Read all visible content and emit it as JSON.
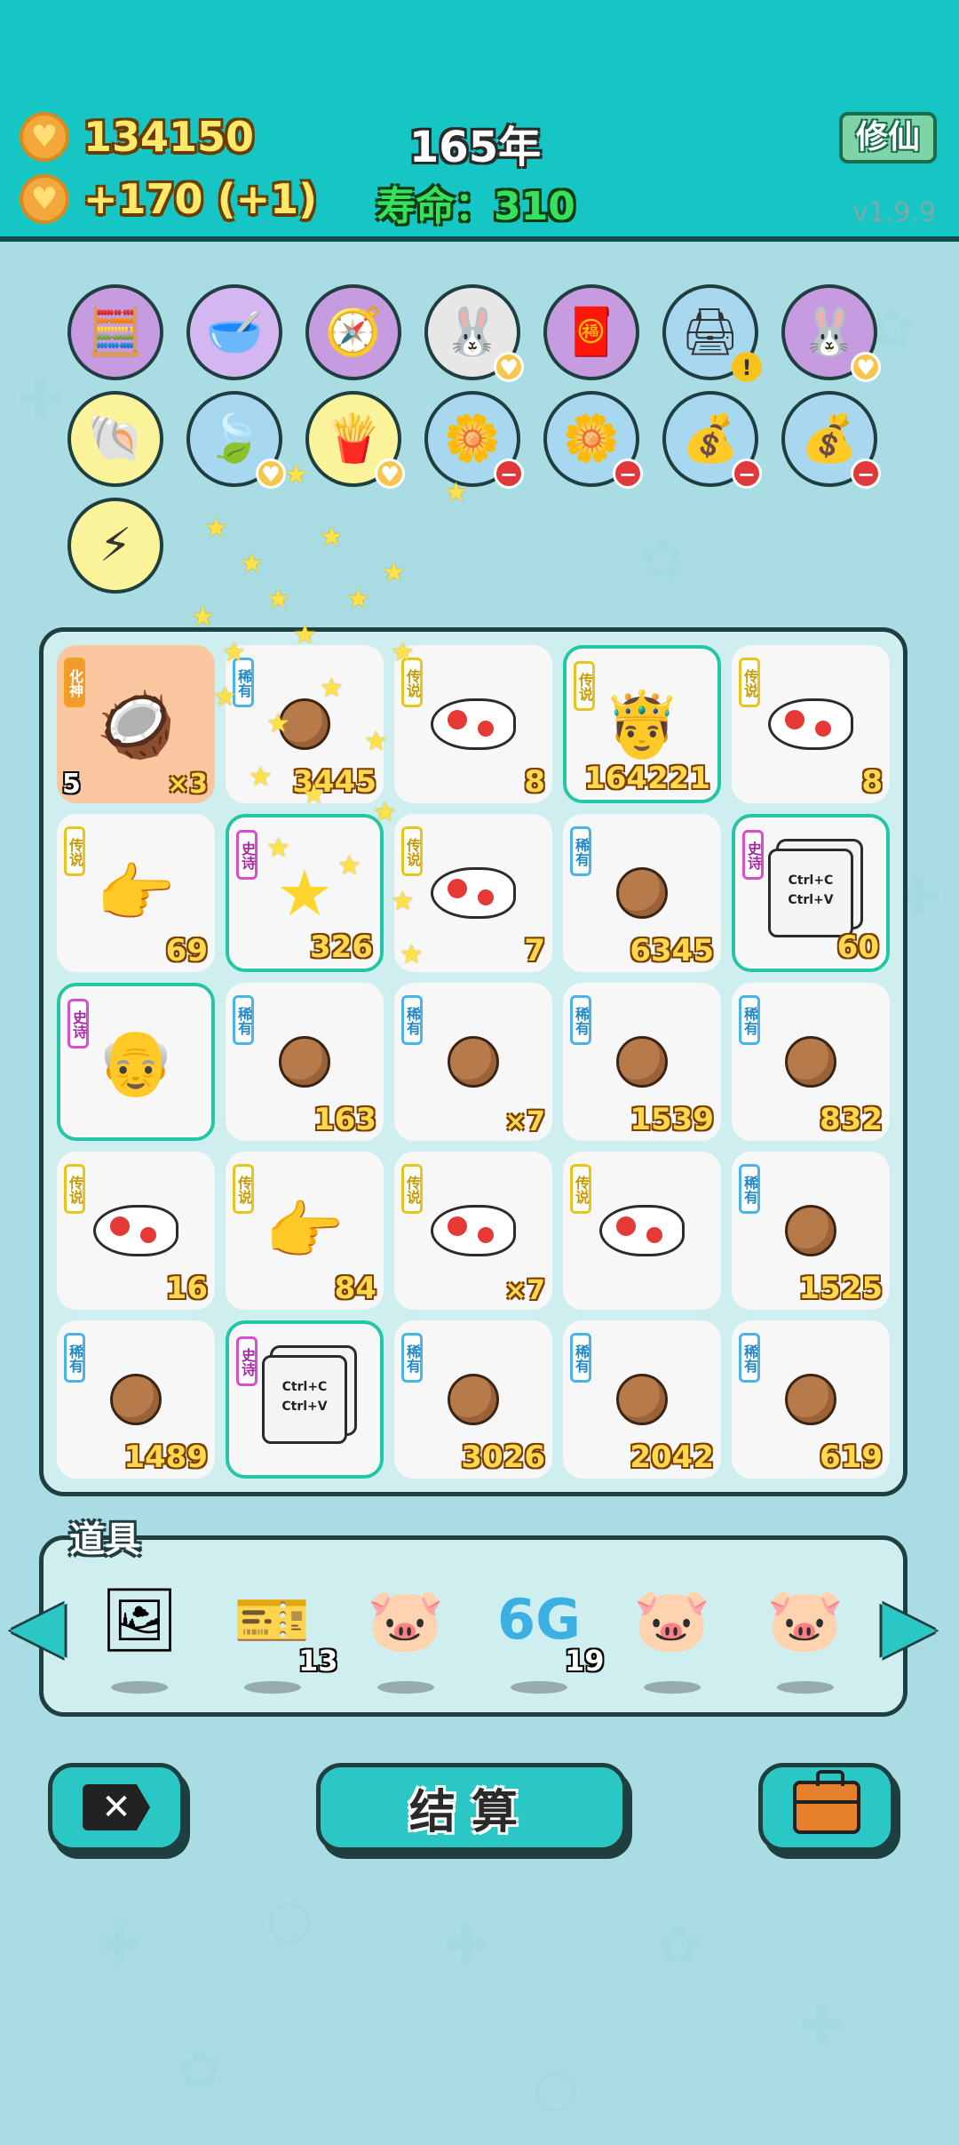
{
  "header": {
    "coins": "134150",
    "income": "+170 (+1)",
    "year": "165年",
    "lifespan": "寿命：310",
    "cultivate_button": "修仙",
    "version": "v1.9.9"
  },
  "buffs": [
    {
      "name": "math-buff",
      "icon": "🧮"
    },
    {
      "name": "pet-bowl-buff",
      "icon": "🥣"
    },
    {
      "name": "compass-buff",
      "icon": "🧭"
    },
    {
      "name": "rabbit-buff",
      "icon": "🐰"
    },
    {
      "name": "red-envelope-buff",
      "icon": "🧧"
    },
    {
      "name": "printer-buff",
      "icon": "🖨"
    },
    {
      "name": "rabbit-buff-2",
      "icon": "🐰"
    },
    {
      "name": "shell-buff",
      "icon": "🐚"
    },
    {
      "name": "leaf-buff",
      "icon": "🍃"
    },
    {
      "name": "fries-buff",
      "icon": "🍟"
    },
    {
      "name": "flower-pot-buff",
      "icon": "🌼"
    },
    {
      "name": "flower-pot-buff-2",
      "icon": "🌼"
    },
    {
      "name": "sack-buff",
      "icon": "💰"
    },
    {
      "name": "sack-buff-2",
      "icon": "💰"
    },
    {
      "name": "lightning-buff",
      "icon": "⚡"
    }
  ],
  "badges": {
    "rare": "稀有",
    "legend": "传说",
    "epic": "史诗",
    "transform": "化神"
  },
  "board": {
    "tiles": [
      {
        "rarity": "transform",
        "item": "coconuts",
        "left_value": "5",
        "value": "×3"
      },
      {
        "rarity": "rare",
        "item": "nut",
        "value": "3445"
      },
      {
        "rarity": "legend",
        "item": "fish",
        "value": "8"
      },
      {
        "rarity": "legend",
        "item": "king",
        "value": "164221"
      },
      {
        "rarity": "legend",
        "item": "fish",
        "value": "8"
      },
      {
        "rarity": "legend",
        "item": "hand",
        "value": "69"
      },
      {
        "rarity": "epic",
        "item": "star-cluster",
        "value": "326"
      },
      {
        "rarity": "legend",
        "item": "fish",
        "value": "7"
      },
      {
        "rarity": "rare",
        "item": "nut",
        "value": "6345"
      },
      {
        "rarity": "epic",
        "item": "copy-paste",
        "value": "60"
      },
      {
        "rarity": "epic",
        "item": "old-man",
        "value": ""
      },
      {
        "rarity": "rare",
        "item": "nut",
        "value": "163"
      },
      {
        "rarity": "rare",
        "item": "nut",
        "value": "×7"
      },
      {
        "rarity": "rare",
        "item": "nut",
        "value": "1539"
      },
      {
        "rarity": "rare",
        "item": "nut",
        "value": "832"
      },
      {
        "rarity": "legend",
        "item": "fish",
        "value": "16"
      },
      {
        "rarity": "legend",
        "item": "hand",
        "value": "84"
      },
      {
        "rarity": "legend",
        "item": "fish",
        "value": "×7"
      },
      {
        "rarity": "legend",
        "item": "fish",
        "value": ""
      },
      {
        "rarity": "rare",
        "item": "nut",
        "value": "1525"
      },
      {
        "rarity": "rare",
        "item": "nut",
        "value": "1489"
      },
      {
        "rarity": "epic",
        "item": "copy-paste",
        "value": ""
      },
      {
        "rarity": "rare",
        "item": "nut",
        "value": "3026"
      },
      {
        "rarity": "rare",
        "item": "nut",
        "value": "2042"
      },
      {
        "rarity": "rare",
        "item": "nut",
        "value": "619"
      }
    ],
    "copy_paste_text": [
      "Ctrl+C",
      "Ctrl+V"
    ]
  },
  "items": {
    "label": "道具",
    "list": [
      {
        "name": "frame-item",
        "icon": "🖼",
        "count": ""
      },
      {
        "name": "legend-tickets-item",
        "icon": "🎫",
        "count": "13"
      },
      {
        "name": "piggy-bank-item",
        "icon": "🐷",
        "count": ""
      },
      {
        "name": "6g-item",
        "icon": "6G",
        "count": "19"
      },
      {
        "name": "piggy-bank-item-2",
        "icon": "🐷",
        "count": ""
      },
      {
        "name": "piggy-bank-item-3",
        "icon": "🐷",
        "count": ""
      }
    ]
  },
  "actions": {
    "settle_label": "结算"
  }
}
